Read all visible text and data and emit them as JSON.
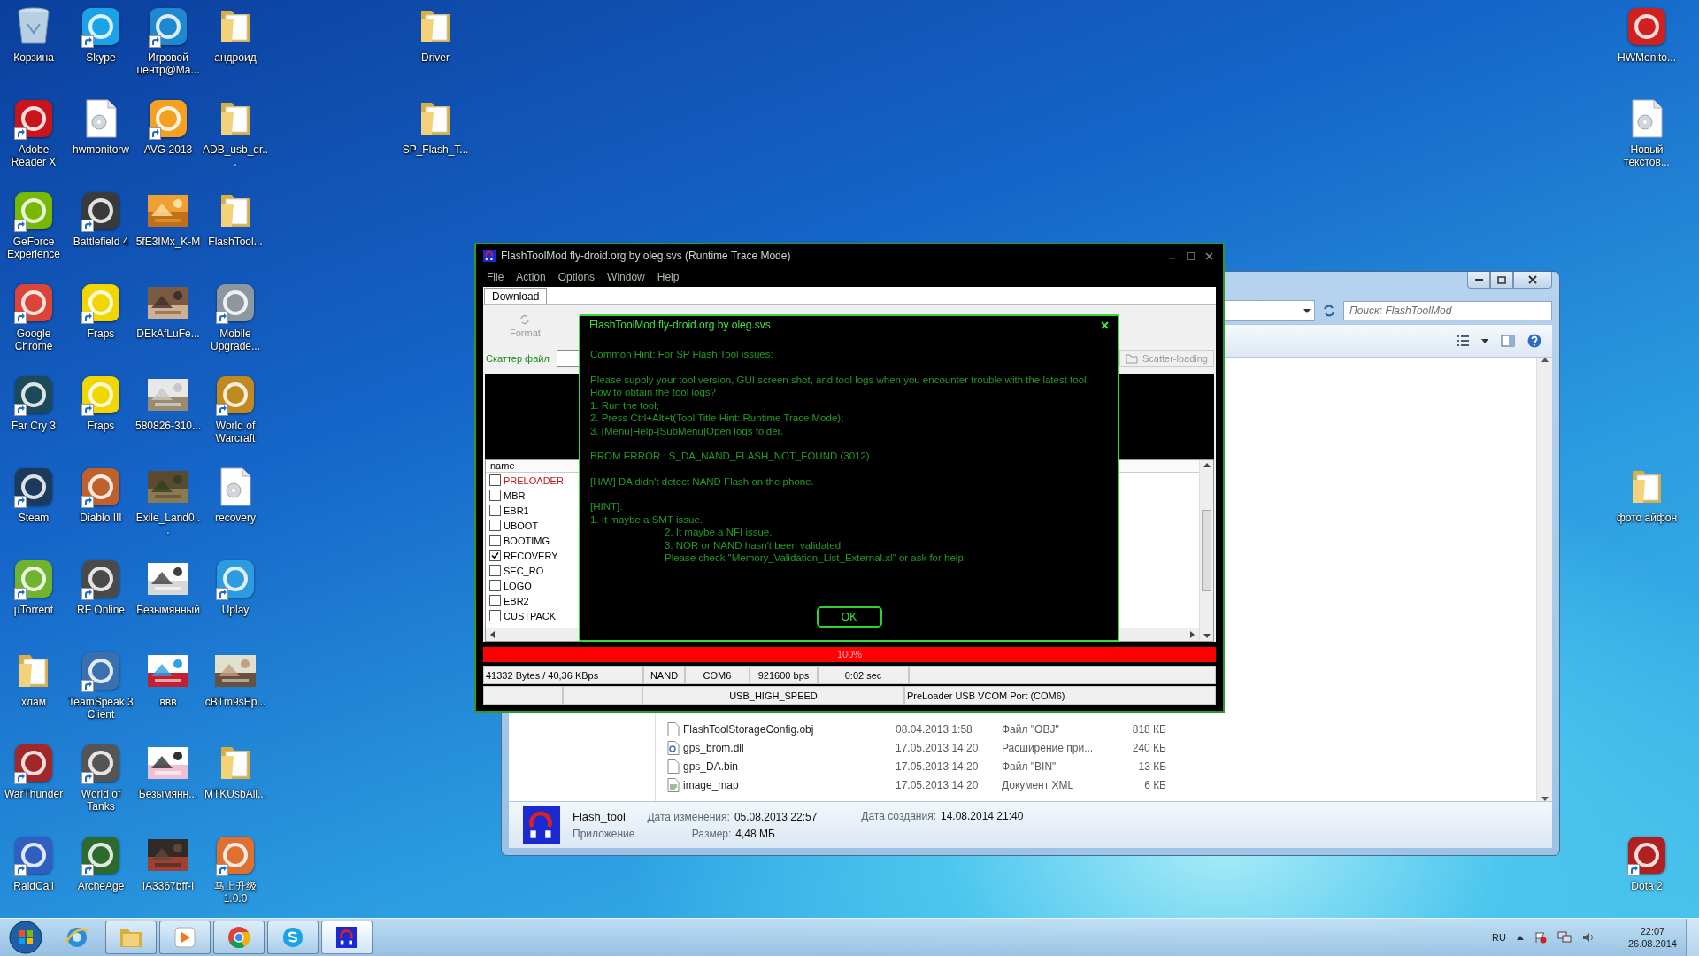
{
  "desktop": {
    "columns": [
      {
        "icons": [
          {
            "label": "Корзина",
            "kind": "recycle",
            "shortcut": false
          },
          {
            "label": "Adobe Reader X",
            "kind": "app",
            "shortcut": true,
            "color": "#c8141a"
          },
          {
            "label": "GeForce Experience",
            "kind": "app",
            "shortcut": true,
            "color": "#76b900"
          },
          {
            "label": "Google Chrome",
            "kind": "app",
            "shortcut": true,
            "color": "#db4437"
          },
          {
            "label": "Far Cry 3",
            "kind": "app",
            "shortcut": true,
            "color": "#1d4a5a"
          },
          {
            "label": "Steam",
            "kind": "app",
            "shortcut": true,
            "color": "#1b3a5c"
          },
          {
            "label": "µTorrent",
            "kind": "app",
            "shortcut": true,
            "color": "#6fb32f"
          },
          {
            "label": "хлам",
            "kind": "folder",
            "shortcut": false
          },
          {
            "label": "WarThunder",
            "kind": "app",
            "shortcut": true,
            "color": "#a02828"
          },
          {
            "label": "RaidCall",
            "kind": "app",
            "shortcut": true,
            "color": "#2f5fc0"
          }
        ]
      },
      {
        "icons": [
          {
            "label": "Skype",
            "kind": "app",
            "shortcut": true,
            "color": "#1aa3e8"
          },
          {
            "label": "hwmonitorw",
            "kind": "document",
            "shortcut": false
          },
          {
            "label": "Battlefield 4",
            "kind": "app",
            "shortcut": true,
            "color": "#3a3a3a"
          },
          {
            "label": "Fraps",
            "kind": "app",
            "shortcut": true,
            "color": "#f2d600"
          },
          {
            "label": "Fraps",
            "kind": "app",
            "shortcut": true,
            "color": "#f2d600"
          },
          {
            "label": "Diablo III",
            "kind": "app",
            "shortcut": true,
            "color": "#c0602a"
          },
          {
            "label": "RF Online",
            "kind": "app",
            "shortcut": true,
            "color": "#4a4a4a"
          },
          {
            "label": "TeamSpeak 3 Client",
            "kind": "app",
            "shortcut": true,
            "color": "#3a6fb0"
          },
          {
            "label": "World of Tanks",
            "kind": "app",
            "shortcut": true,
            "color": "#555555"
          },
          {
            "label": "ArcheAge",
            "kind": "app",
            "shortcut": true,
            "color": "#2d6a2d"
          }
        ]
      },
      {
        "icons": [
          {
            "label": "Игровой центр@Ma...",
            "kind": "app",
            "shortcut": true,
            "color": "#1e88d0"
          },
          {
            "label": "AVG 2013",
            "kind": "app",
            "shortcut": true,
            "color": "#f4a020"
          },
          {
            "label": "5fE3IMx_K-M",
            "kind": "picture",
            "shortcut": false
          },
          {
            "label": "DEkAfLuFe...",
            "kind": "picture",
            "shortcut": false
          },
          {
            "label": "580826-310...",
            "kind": "picture",
            "shortcut": false
          },
          {
            "label": "Exile_Land0...",
            "kind": "picture",
            "shortcut": false
          },
          {
            "label": "Безымянный",
            "kind": "picture",
            "shortcut": false
          },
          {
            "label": "ввв",
            "kind": "picture",
            "shortcut": false
          },
          {
            "label": "Безымянн...",
            "kind": "picture",
            "shortcut": false
          },
          {
            "label": "IA3367bff-I",
            "kind": "picture",
            "shortcut": false
          }
        ]
      },
      {
        "icons": [
          {
            "label": "андроид",
            "kind": "folder",
            "shortcut": false
          },
          {
            "label": "ADB_usb_dr...",
            "kind": "folder",
            "shortcut": false
          },
          {
            "label": "FlashTool...",
            "kind": "folder",
            "shortcut": false
          },
          {
            "label": "Mobile Upgrade...",
            "kind": "app",
            "shortcut": true,
            "color": "#8d979f"
          },
          {
            "label": "World of Warcraft",
            "kind": "app",
            "shortcut": true,
            "color": "#c08a20"
          },
          {
            "label": "recovery",
            "kind": "document",
            "shortcut": false
          },
          {
            "label": "Uplay",
            "kind": "app",
            "shortcut": true,
            "color": "#2c9be0"
          },
          {
            "label": "cBTm9sEp...",
            "kind": "picture",
            "shortcut": false
          },
          {
            "label": "MTKUsbAll...",
            "kind": "folder",
            "shortcut": false
          },
          {
            "label": "马上升级 1.0.0",
            "kind": "app",
            "shortcut": true,
            "color": "#e07030"
          }
        ]
      },
      {
        "icons": [
          {
            "label": "Driver",
            "kind": "folder",
            "shortcut": false
          },
          {
            "label": "SP_Flash_T...",
            "kind": "folder",
            "shortcut": false
          }
        ]
      },
      {
        "icons": [
          {
            "label": "HWMonito...",
            "kind": "app",
            "shortcut": false,
            "color": "#d02020"
          },
          {
            "label": "Новый текстов...",
            "kind": "document",
            "shortcut": false
          },
          {
            "label": "фото айфон",
            "kind": "folder",
            "shortcut": false
          },
          {
            "label": "Dota 2",
            "kind": "app",
            "shortcut": true,
            "color": "#b02020"
          }
        ]
      }
    ]
  },
  "explorer": {
    "search": {
      "placeholder": "Поиск: FlashToolMod"
    },
    "files": [
      {
        "name": "FlashToolStorageConfig.obj",
        "date": "08.04.2013 1:58",
        "type": "Файл \"OBJ\"",
        "size": "818 КБ",
        "kind": "blank"
      },
      {
        "name": "gps_brom.dll",
        "date": "17.05.2013 14:20",
        "type": "Расширение при...",
        "size": "240 КБ",
        "kind": "dll"
      },
      {
        "name": "gps_DA.bin",
        "date": "17.05.2013 14:20",
        "type": "Файл \"BIN\"",
        "size": "13 КБ",
        "kind": "blank"
      },
      {
        "name": "image_map",
        "date": "17.05.2013 14:20",
        "type": "Документ XML",
        "size": "6 КБ",
        "kind": "xml"
      }
    ],
    "details": {
      "name": "Flash_tool",
      "type": "Приложение",
      "modified_label": "Дата изменения:",
      "modified": "05.08.2013 22:57",
      "size_label": "Размер:",
      "size": "4,48 МБ",
      "created_label": "Дата создания:",
      "created": "14.08.2014 21:40"
    }
  },
  "flashtool": {
    "title": "FlashToolMod fly-droid.org by oleg.svs (Runtime Trace Mode)",
    "menu": [
      "File",
      "Action",
      "Options",
      "Window",
      "Help"
    ],
    "tabs": [
      {
        "label": "Download",
        "selected": true
      }
    ],
    "toolbar": [
      {
        "label": "Format",
        "disabled": true
      }
    ],
    "scatter_label": "Скаттер файл",
    "scatter_button": {
      "label": "Scatter-loading",
      "disabled": true
    },
    "list_header": "name",
    "partitions": [
      {
        "name": "PRELOADER",
        "checked": false,
        "highlighted": true
      },
      {
        "name": "MBR",
        "checked": false,
        "highlighted": false
      },
      {
        "name": "EBR1",
        "checked": false,
        "highlighted": false
      },
      {
        "name": "UBOOT",
        "checked": false,
        "highlighted": false
      },
      {
        "name": "BOOTIMG",
        "checked": false,
        "highlighted": false
      },
      {
        "name": "RECOVERY",
        "checked": true,
        "highlighted": false
      },
      {
        "name": "SEC_RO",
        "checked": false,
        "highlighted": false
      },
      {
        "name": "LOGO",
        "checked": false,
        "highlighted": false
      },
      {
        "name": "EBR2",
        "checked": false,
        "highlighted": false
      },
      {
        "name": "CUSTPACK",
        "checked": false,
        "highlighted": false
      }
    ],
    "progress": {
      "level": 1,
      "text": "100%"
    },
    "status_rows": [
      {
        "cells": [
          "41332 Bytes / 40,36 KBps",
          "NAND",
          "COM6",
          "921600 bps",
          "0:02 sec"
        ]
      },
      {
        "cells": [
          "USB_HIGH_SPEED",
          "PreLoader USB VCOM Port (COM6)"
        ]
      }
    ]
  },
  "dialog": {
    "title": "FlashToolMod fly-droid.org by oleg.svs",
    "paragraphs": [
      {
        "lines": [
          {
            "text": "Common Hint: For SP Flash Tool issues:",
            "indented": false
          }
        ]
      },
      {
        "lines": [
          {
            "text": "Please supply your tool version, GUI screen shot, and tool logs when you encounter trouble with the latest tool.",
            "indented": false
          },
          {
            "text": "How to obtain the tool logs?",
            "indented": false
          },
          {
            "text": "1. Run the tool;",
            "indented": false
          },
          {
            "text": "2. Press Ctrl+Alt+t(Tool Title Hint: Runtime Trace Mode);",
            "indented": false
          },
          {
            "text": "3. [Menu]Help-[SubMenu]Open logs folder.",
            "indented": false
          }
        ]
      },
      {
        "lines": [
          {
            "text": "BROM ERROR : S_DA_NAND_FLASH_NOT_FOUND (3012)",
            "indented": false
          }
        ]
      },
      {
        "lines": [
          {
            "text": "[H/W] DA didn't detect NAND Flash on the phone.",
            "indented": false
          }
        ]
      },
      {
        "lines": [
          {
            "text": "[HINT]:",
            "indented": false
          },
          {
            "text": "1. It maybe a SMT issue.",
            "indented": false
          },
          {
            "text": "2. It maybe a NFI issue.",
            "indented": true
          },
          {
            "text": "3. NOR or NAND hasn't been validated.",
            "indented": true
          },
          {
            "text": "Please check \"Memory_Validation_List_External.xl\" or ask for help.",
            "indented": true
          }
        ]
      }
    ],
    "button": "OK"
  },
  "taskbar": {
    "buttons": [
      {
        "kind": "browser",
        "running": false,
        "active": false
      },
      {
        "kind": "explorer",
        "running": true,
        "active": false
      },
      {
        "kind": "media",
        "running": true,
        "active": false
      },
      {
        "kind": "chrome",
        "running": true,
        "active": false
      },
      {
        "kind": "skype",
        "running": true,
        "active": false
      },
      {
        "kind": "flashtool",
        "running": true,
        "active": true
      }
    ],
    "language": "RU",
    "time": "22:07",
    "date": "26.08.2014"
  }
}
